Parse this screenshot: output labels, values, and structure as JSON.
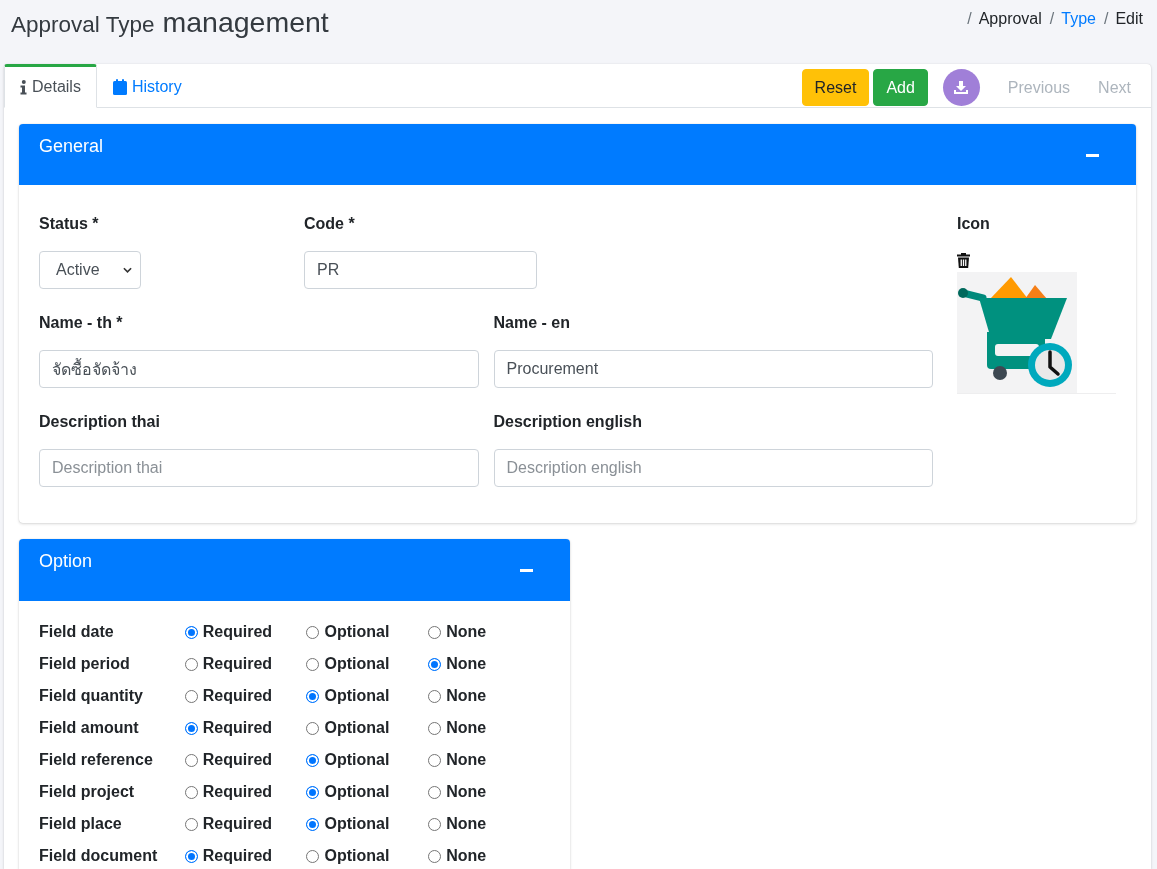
{
  "header": {
    "title": "Approval Type",
    "subtitle": "management"
  },
  "breadcrumb": {
    "separator": "/",
    "items": [
      {
        "label": "Approval",
        "link": false
      },
      {
        "label": "Type",
        "link": true
      },
      {
        "label": "Edit",
        "link": false
      }
    ]
  },
  "tabs": [
    {
      "label": "Details",
      "selected": true
    },
    {
      "label": "History",
      "selected": false
    }
  ],
  "toolbar": {
    "buttons": [
      {
        "kind": "warning",
        "label": "Reset",
        "disabled": false
      },
      {
        "kind": "success",
        "label": "Add",
        "disabled": false
      },
      {
        "kind": "download",
        "disabled": false
      },
      {
        "kind": "link",
        "label": "Previous",
        "disabled": true
      },
      {
        "kind": "link",
        "label": "Next",
        "disabled": true
      }
    ]
  },
  "general": {
    "title": "General",
    "expanded": true,
    "status": {
      "label": "Status *",
      "value": "Active"
    },
    "code": {
      "label": "Code *",
      "value": "PR"
    },
    "name_th": {
      "label": "Name - th *",
      "value": "จัดซื้อจัดจ้าง"
    },
    "name_en": {
      "label": "Name - en",
      "value": "Procurement"
    },
    "description_th": {
      "label": "Description thai",
      "placeholder": "Description thai"
    },
    "description_en": {
      "label": "Description english",
      "placeholder": "Description english"
    },
    "icon": {
      "label": "Icon"
    }
  },
  "option": {
    "title": "Option",
    "expanded": true,
    "fields": [
      {
        "label": "Field date",
        "choices": [
          {
            "label": "Required",
            "selected": true
          },
          {
            "label": "Optional",
            "selected": false
          },
          {
            "label": "None",
            "selected": false
          }
        ]
      },
      {
        "label": "Field period",
        "choices": [
          {
            "label": "Required",
            "selected": false
          },
          {
            "label": "Optional",
            "selected": false
          },
          {
            "label": "None",
            "selected": true
          }
        ]
      },
      {
        "label": "Field quantity",
        "choices": [
          {
            "label": "Required",
            "selected": false
          },
          {
            "label": "Optional",
            "selected": true
          },
          {
            "label": "None",
            "selected": false
          }
        ]
      },
      {
        "label": "Field amount",
        "choices": [
          {
            "label": "Required",
            "selected": true
          },
          {
            "label": "Optional",
            "selected": false
          },
          {
            "label": "None",
            "selected": false
          }
        ]
      },
      {
        "label": "Field reference",
        "choices": [
          {
            "label": "Required",
            "selected": false
          },
          {
            "label": "Optional",
            "selected": true
          },
          {
            "label": "None",
            "selected": false
          }
        ]
      },
      {
        "label": "Field project",
        "choices": [
          {
            "label": "Required",
            "selected": false
          },
          {
            "label": "Optional",
            "selected": true
          },
          {
            "label": "None",
            "selected": false
          }
        ]
      },
      {
        "label": "Field place",
        "choices": [
          {
            "label": "Required",
            "selected": false
          },
          {
            "label": "Optional",
            "selected": true
          },
          {
            "label": "None",
            "selected": false
          }
        ]
      },
      {
        "label": "Field document",
        "choices": [
          {
            "label": "Required",
            "selected": true
          },
          {
            "label": "Optional",
            "selected": false
          },
          {
            "label": "None",
            "selected": false
          }
        ]
      }
    ]
  }
}
